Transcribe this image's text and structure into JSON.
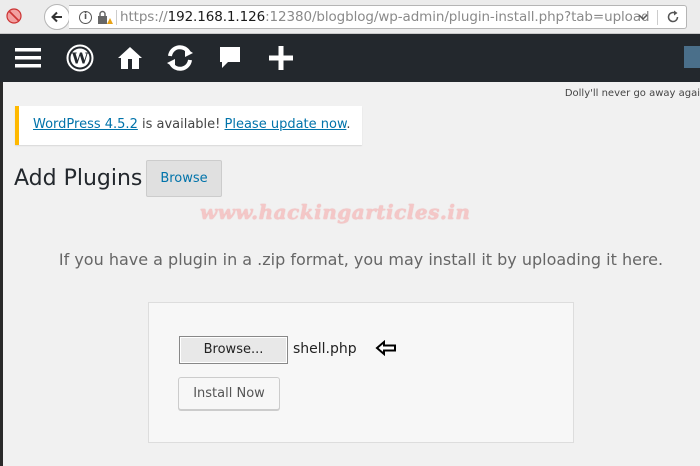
{
  "browser": {
    "url_prefix": "https://",
    "url_host": "192.168.1.126",
    "url_rest": ":12380/blogblog/wp-admin/plugin-install.php?tab=upload"
  },
  "adminbar": {
    "icons": [
      "menu-icon",
      "wordpress-logo-icon",
      "home-icon",
      "updates-icon",
      "comments-icon",
      "new-content-icon"
    ],
    "bg_color": "#23282d"
  },
  "dolly": "Dolly'll never go away agai",
  "notice": {
    "link1": "WordPress 4.5.2",
    "middle": " is available! ",
    "link2": "Please update now",
    "end": "."
  },
  "page": {
    "title": "Add Plugins",
    "browse_tab": "Browse"
  },
  "watermark": "www.hackingarticles.in",
  "upload": {
    "help": "If you have a plugin in a .zip format, you may install it by uploading it here.",
    "browse_button": "Browse...",
    "file_name": "shell.php",
    "install_button": "Install Now"
  }
}
